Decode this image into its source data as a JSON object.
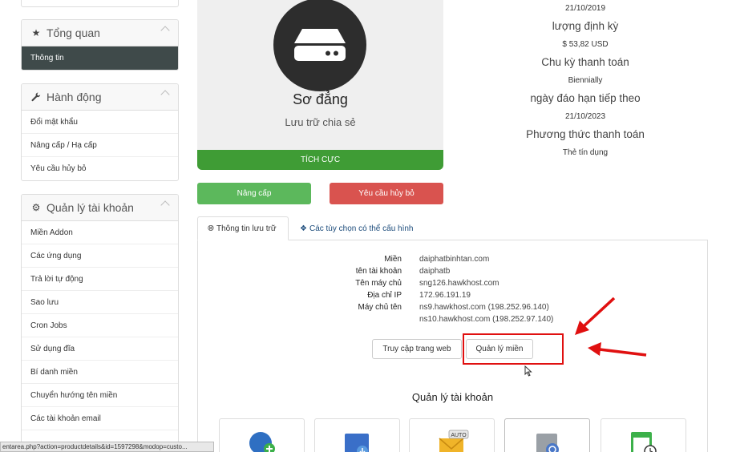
{
  "sidebar": {
    "overview": {
      "title": "Tổng quan",
      "items": [
        {
          "label": "Thông tin"
        }
      ]
    },
    "actions": {
      "title": "Hành động",
      "items": [
        {
          "label": "Đổi mật khẩu"
        },
        {
          "label": "Nâng cấp / Hạ cấp"
        },
        {
          "label": "Yêu cầu hủy bỏ"
        }
      ]
    },
    "account": {
      "title": "Quản lý tài khoản",
      "items": [
        {
          "label": "Miền Addon"
        },
        {
          "label": "Các ứng dụng"
        },
        {
          "label": "Trả lời tự động"
        },
        {
          "label": "Sao lưu"
        },
        {
          "label": "Cron Jobs"
        },
        {
          "label": "Sử dụng đĩa"
        },
        {
          "label": "Bí danh miền"
        },
        {
          "label": "Chuyển hướng tên miền"
        },
        {
          "label": "Các tài khoản email"
        }
      ]
    }
  },
  "product": {
    "name": "Sơ đẳng",
    "group": "Lưu trữ chia sẻ",
    "status": "TÍCH CỰC"
  },
  "buttons": {
    "upgrade": "Nâng cấp",
    "cancel": "Yêu cầu hủy bỏ"
  },
  "info": {
    "reg_date": "21/10/2019",
    "recurring_label": "lượng định kỳ",
    "recurring_value": "$ 53,82 USD",
    "cycle_label": "Chu kỳ thanh toán",
    "cycle_value": "Biennially",
    "due_label": "ngày đáo hạn tiếp theo",
    "due_value": "21/10/2023",
    "method_label": "Phương thức thanh toán",
    "method_value": "Thẻ tín dụng"
  },
  "tabs": [
    {
      "label": "Thông tin lưu trữ"
    },
    {
      "label": "Các tùy chọn có thể cấu hình"
    }
  ],
  "hosting": {
    "domain_label": "Miền",
    "domain_value": "daiphatbinhtan.com",
    "user_label": "tên tài khoản",
    "user_value": "daiphatb",
    "server_label": "Tên máy chủ",
    "server_value": "sng126.hawkhost.com",
    "ip_label": "Địa chỉ IP",
    "ip_value": "172.96.191.19",
    "ns_label": "Máy chủ tên",
    "ns1": "ns9.hawkhost.com (198.252.96.140)",
    "ns2": "ns10.hawkhost.com (198.252.97.140)"
  },
  "actions": {
    "visit": "Truy cập trang web",
    "manage_domain": "Quản lý miền"
  },
  "section": {
    "title": "Quản lý tài khoản"
  },
  "status_url": "entarea.php?action=productdetails&id=1597298&modop=custo...",
  "colors": {
    "success": "#5cb85c",
    "danger": "#d9534f",
    "active_status": "#3f9c35",
    "highlight": "#e01010"
  }
}
